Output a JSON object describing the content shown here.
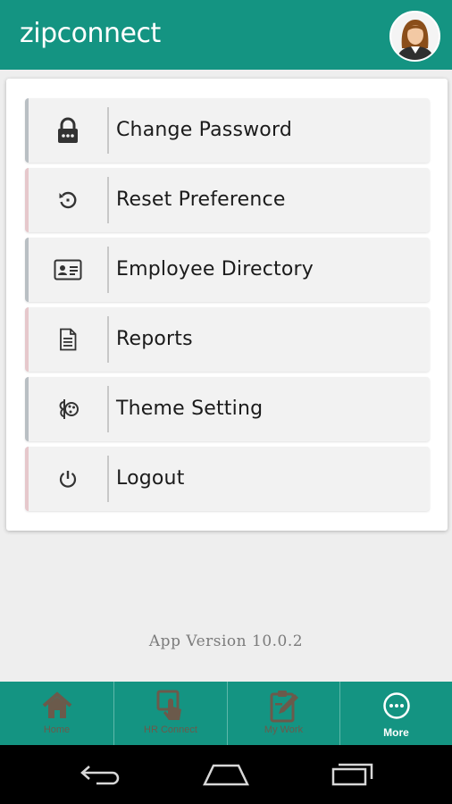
{
  "header": {
    "logo_text": "zipconnect",
    "background": "#149482",
    "avatar_icon": "user-avatar-female"
  },
  "menu": {
    "items": [
      {
        "label": "Change Password",
        "icon": "lock-icon",
        "accent": "#b9bfc3"
      },
      {
        "label": "Reset Preference",
        "icon": "reset-icon",
        "accent": "#e6c8cc"
      },
      {
        "label": "Employee Directory",
        "icon": "id-card-icon",
        "accent": "#b9bfc3"
      },
      {
        "label": "Reports",
        "icon": "document-icon",
        "accent": "#e6c8cc"
      },
      {
        "label": "Theme Setting",
        "icon": "palette-icon",
        "accent": "#b9bfc3"
      },
      {
        "label": "Logout",
        "icon": "power-icon",
        "accent": "#e6c8cc"
      }
    ]
  },
  "footer": {
    "app_version": "App Version 10.0.2"
  },
  "tabbar": {
    "tabs": [
      {
        "label": "Home",
        "icon": "home-icon",
        "active": false
      },
      {
        "label": "HR Connect",
        "icon": "touch-screen-icon",
        "active": false
      },
      {
        "label": "My Work",
        "icon": "clipboard-edit-icon",
        "active": false
      },
      {
        "label": "More",
        "icon": "more-icon",
        "active": true
      }
    ]
  },
  "system_nav": {
    "buttons": [
      "back-icon",
      "home-nav-icon",
      "recent-apps-icon"
    ]
  }
}
